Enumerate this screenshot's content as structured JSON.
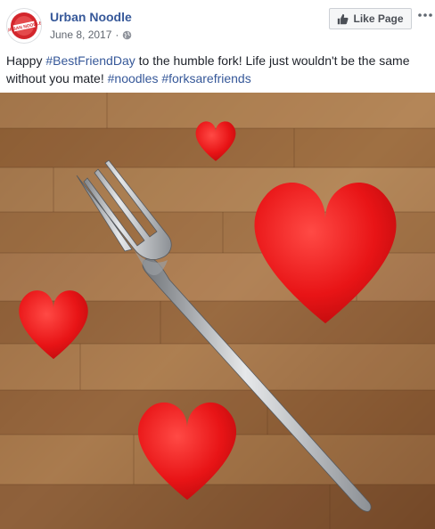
{
  "page": {
    "name": "Urban Noodle",
    "avatar_text": "URBAN NOODLE"
  },
  "post": {
    "date": "June 8, 2017",
    "separator": "·",
    "privacy_icon": "globe-icon",
    "text_parts": {
      "p1": "Happy ",
      "hashtag_best_friend_day": "#BestFriendDay",
      "p2": " to the humble fork! Life just wouldn't be the same without you mate! ",
      "hashtag_noodles": "#noodles",
      "p3": " ",
      "hashtag_forks": "#forksarefriends"
    }
  },
  "actions": {
    "like_page_label": "Like Page",
    "like_icon": "thumbs-up-icon",
    "more_icon": "more-options-icon"
  },
  "photo": {
    "subject": "fork-with-hearts",
    "colors": {
      "wood": "#a9774c",
      "heart": "#e81416",
      "fork": "#b8babd"
    }
  },
  "colors": {
    "link": "#365899",
    "text": "#1d2129",
    "meta": "#616770",
    "button_bg": "#f5f6f7"
  }
}
